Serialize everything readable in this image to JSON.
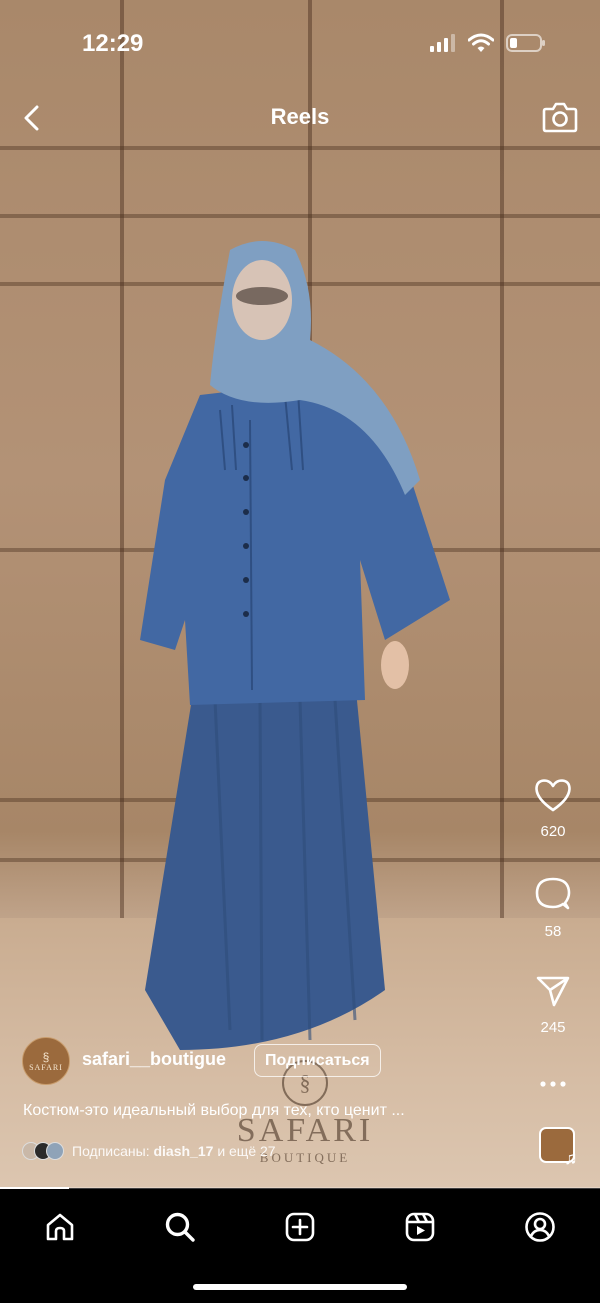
{
  "status_bar": {
    "time": "12:29"
  },
  "header": {
    "title": "Reels"
  },
  "actions": {
    "likes": "620",
    "comments": "58",
    "shares": "245"
  },
  "post": {
    "username": "safari__boutigue",
    "follow_label": "Подписаться",
    "caption": "Костюм-это идеальный выбор для тех, кто ценит ...",
    "followers_prefix": "Подписаны:",
    "followers_names": "diash_17",
    "followers_suffix": "и ещё 27",
    "avatar_text": "SAFARI"
  },
  "watermark": {
    "name": "SAFARI",
    "sub": "BOUTIQUE"
  },
  "progress": 0.115,
  "icons": [
    "back-icon",
    "camera-icon",
    "heart-icon",
    "comment-icon",
    "send-icon",
    "more-icon",
    "music-note-icon",
    "home-icon",
    "search-icon",
    "create-icon",
    "reels-icon",
    "profile-icon"
  ],
  "colors": {
    "background": "#000000",
    "text": "#ffffff",
    "brand": "#9b6a3d",
    "outfit": "#3f5f93"
  }
}
